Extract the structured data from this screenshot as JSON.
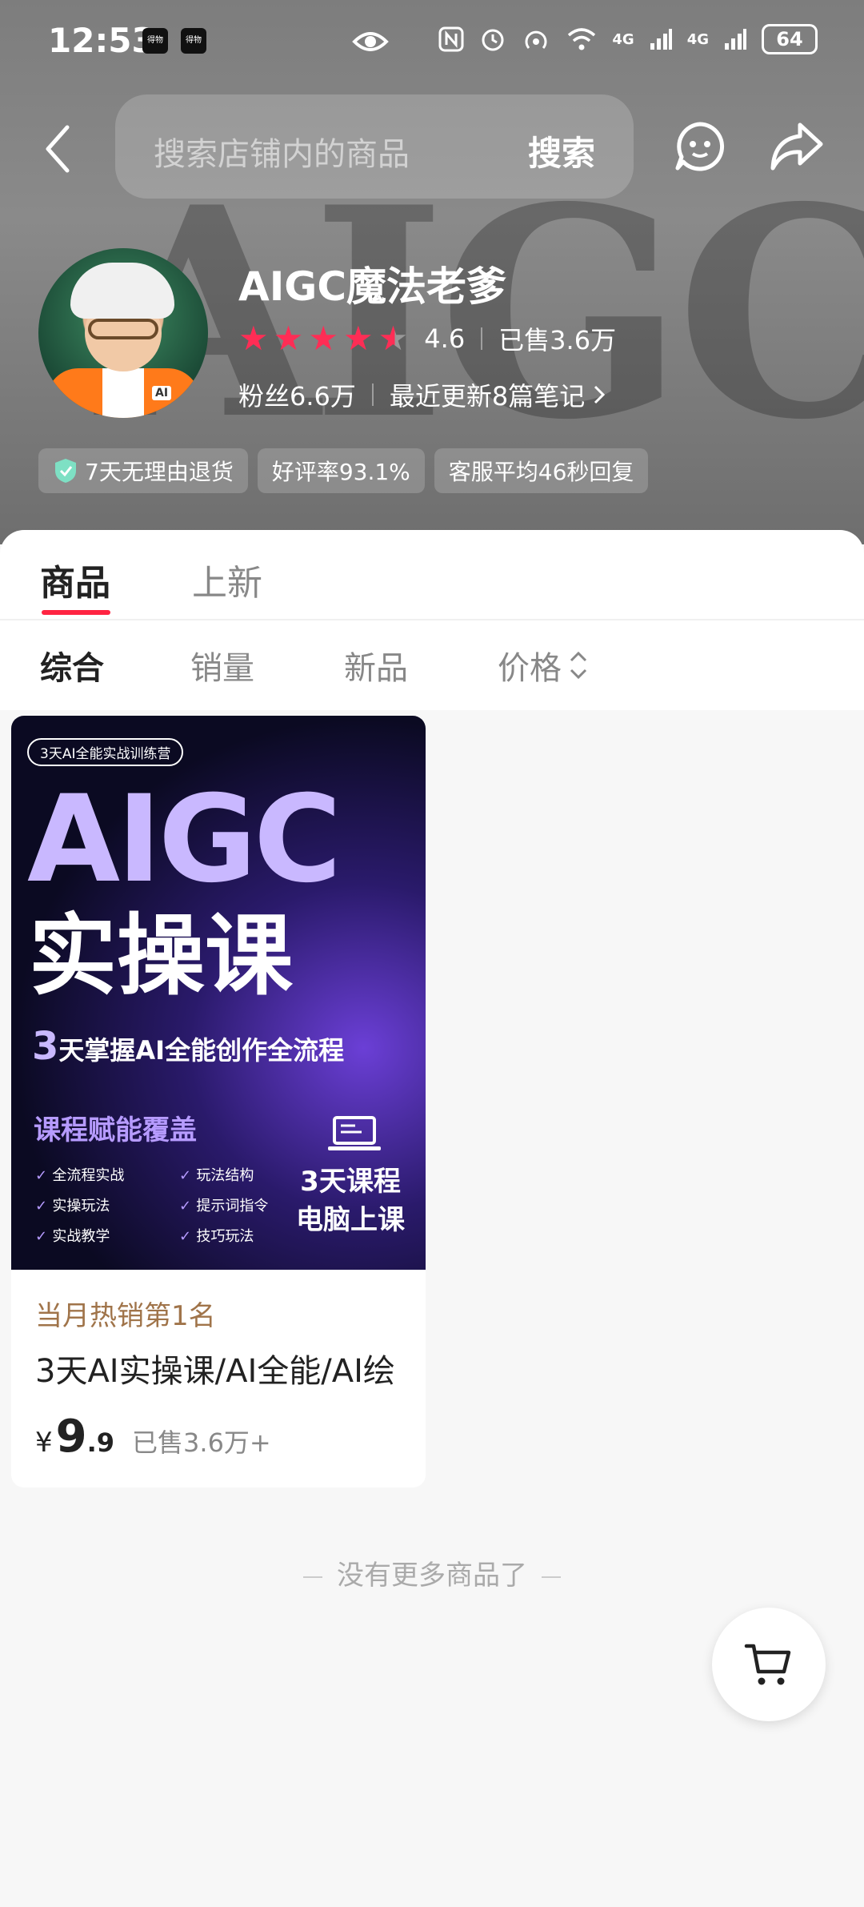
{
  "status_bar": {
    "time": "12:53",
    "app_icons": [
      "得物",
      "得物"
    ],
    "battery": "64",
    "network": [
      "4G",
      "4G"
    ]
  },
  "search": {
    "placeholder": "搜索店铺内的商品",
    "button_label": "搜索"
  },
  "shop": {
    "watermark": "AIGC",
    "name": "AIGC魔法老爹",
    "rating": "4.6",
    "rating_stars": 4.6,
    "sold": "已售3.6万",
    "fans": "粉丝6.6万",
    "notes": "最近更新8篇笔记",
    "avatar_badge": "AI",
    "tags": [
      "7天无理由退货",
      "好评率93.1%",
      "客服平均46秒回复"
    ]
  },
  "tabs": [
    "商品",
    "上新"
  ],
  "sort_options": [
    "综合",
    "销量",
    "新品",
    "价格"
  ],
  "product": {
    "cover": {
      "chip": "3天AI全能实战训练营",
      "headline": "AIGC",
      "title": "实操课",
      "subtitle_num": "3",
      "subtitle": "天掌握AI全能创作全流程",
      "section": "课程赋能覆盖",
      "features": [
        "全流程实战",
        "玩法结构",
        "实操玩法",
        "提示词指令",
        "实战教学",
        "技巧玩法"
      ],
      "days_line1": "3天课程",
      "days_line2": "电脑上课"
    },
    "badge": "当月热销第1名",
    "name": "3天AI实操课/AI全能/AI绘",
    "currency": "¥",
    "price_int": "9",
    "price_dec": ".9",
    "sold": "已售3.6万+"
  },
  "footer_note": "没有更多商品了",
  "colors": {
    "accent": "#ff2442",
    "star": "#ff2d55",
    "badge_text": "#a0744a"
  },
  "icons": [
    "back-icon",
    "chat-icon",
    "share-icon",
    "shield-check-icon",
    "sort-chevron-icon",
    "laptop-icon",
    "cart-icon",
    "eye-icon"
  ]
}
